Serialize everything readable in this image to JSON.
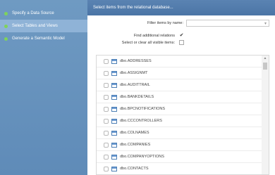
{
  "sidebar": {
    "steps": [
      {
        "label": "Specify a Data Source"
      },
      {
        "label": "Select Tables and Views"
      },
      {
        "label": "Generate a Semantic Model"
      }
    ]
  },
  "panel": {
    "header": "Select items from the relational database...",
    "filter_label": "Filter items by name:",
    "filter_value": "",
    "find_label": "Find additional relations",
    "find_checked": true,
    "select_label": "Select or clear all visible items:",
    "select_checked": false
  },
  "items": [
    "dbo.ADDRESSES",
    "dbo.ASSIGNMT",
    "dbo.AUDITTRAIL",
    "dbo.BANKDETAILS",
    "dbo.BPCNOTIFICATIONS",
    "dbo.CCCONTROLLERS",
    "dbo.COLNAMES",
    "dbo.COMPANIES",
    "dbo.COMPANYOPTIONS",
    "dbo.CONTACTS"
  ]
}
